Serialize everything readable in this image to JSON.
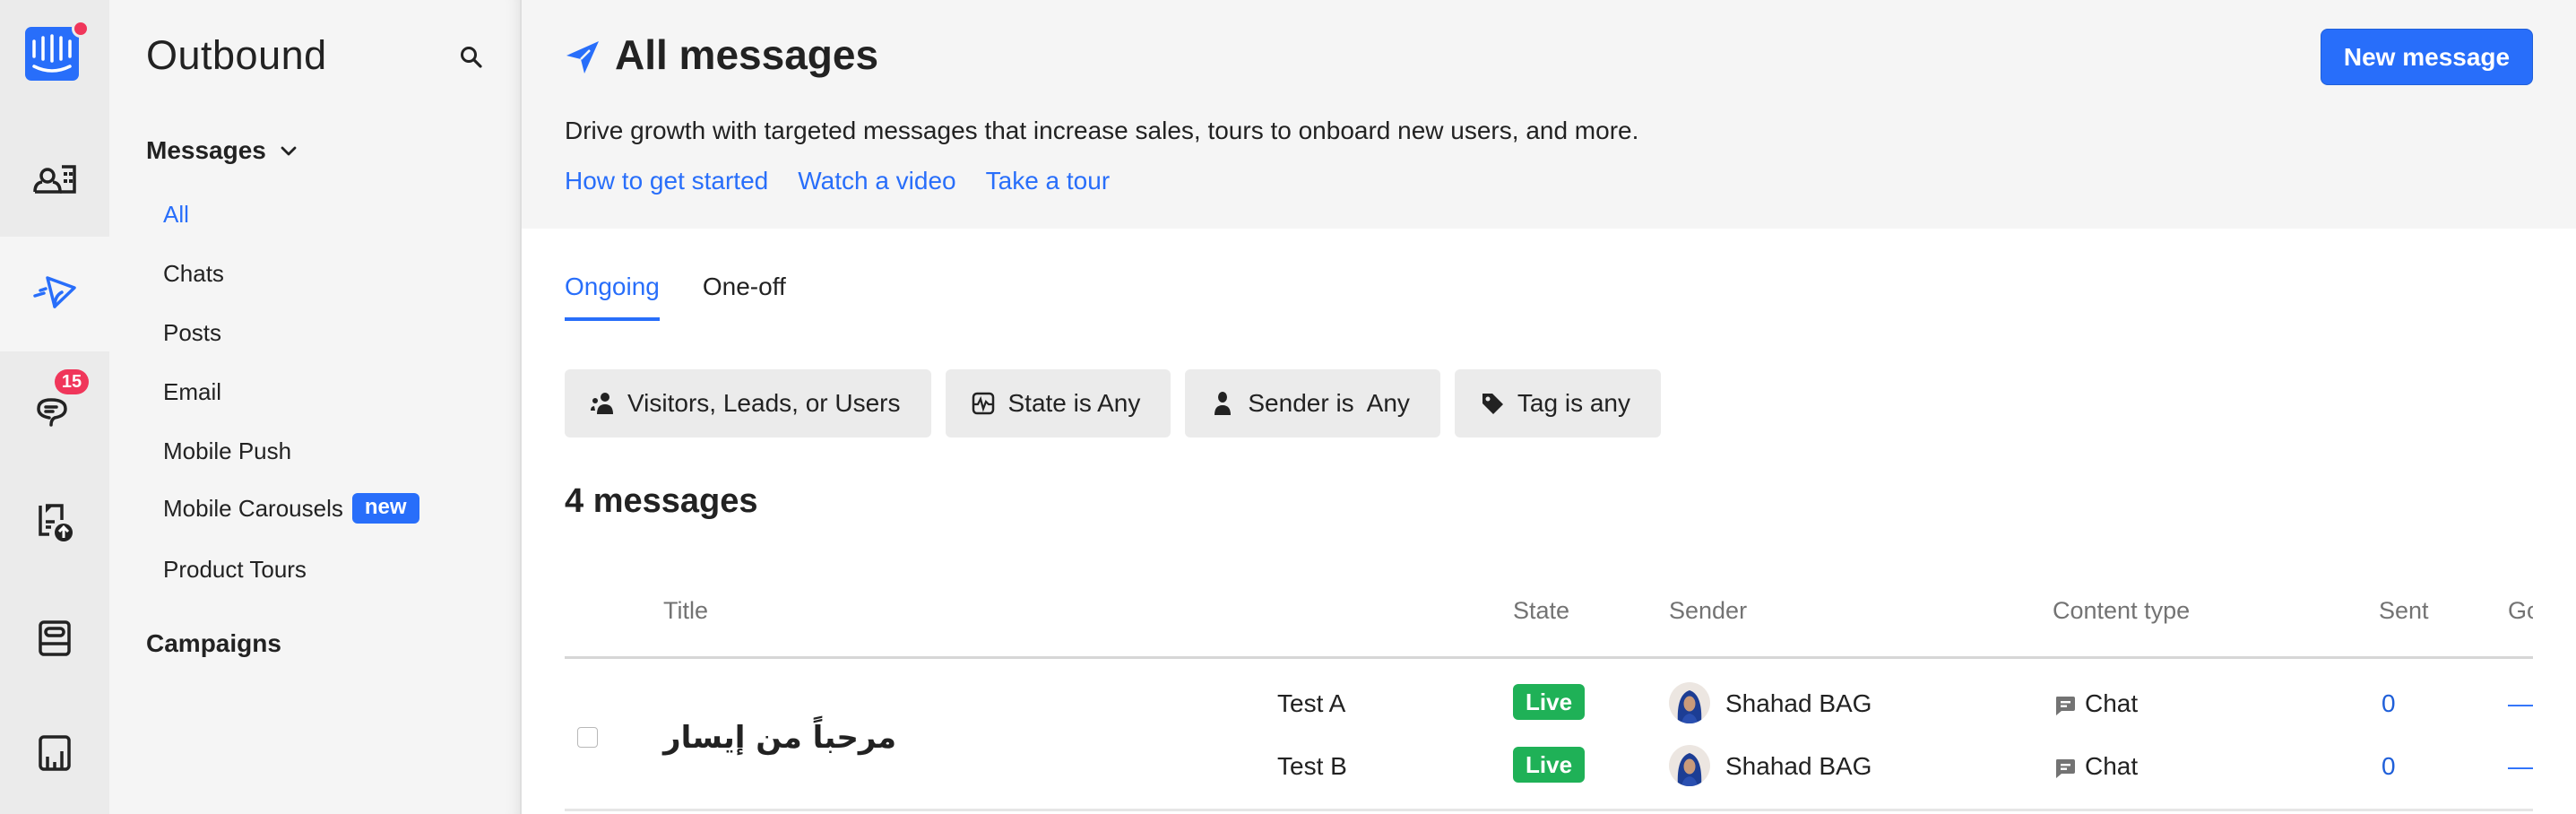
{
  "colors": {
    "accent": "#286efa",
    "badge_red": "#f0365a",
    "live_green": "#1fb157",
    "rail_bg": "#ebebeb",
    "panel_bg": "#f5f5f5"
  },
  "rail": {
    "logo": "intercom-logo",
    "items": [
      {
        "icon": "contacts-icon",
        "active": false
      },
      {
        "icon": "outbound-send-icon",
        "active": true
      },
      {
        "icon": "conversations-icon",
        "active": false,
        "badge": "15"
      },
      {
        "icon": "articles-upload-icon",
        "active": false
      },
      {
        "icon": "inbox-tray-icon",
        "active": false
      },
      {
        "icon": "reports-chart-icon",
        "active": false
      }
    ]
  },
  "sidebar": {
    "title": "Outbound",
    "search_icon": "search-icon",
    "messages_section": "Messages",
    "items": [
      {
        "label": "All",
        "active": true
      },
      {
        "label": "Chats"
      },
      {
        "label": "Posts"
      },
      {
        "label": "Email"
      },
      {
        "label": "Mobile Push"
      },
      {
        "label": "Mobile Carousels",
        "badge": "new"
      },
      {
        "label": "Product Tours"
      }
    ],
    "campaigns_section": "Campaigns"
  },
  "header": {
    "title": "All messages",
    "description": "Drive growth with targeted messages that increase sales, tours to onboard new users, and more.",
    "links": [
      "How to get started",
      "Watch a video",
      "Take a tour"
    ],
    "new_message_button": "New message"
  },
  "tabs": [
    {
      "label": "Ongoing",
      "active": true
    },
    {
      "label": "One-off",
      "active": false
    }
  ],
  "filters": [
    {
      "icon": "people-icon",
      "label": "Visitors, Leads, or Users"
    },
    {
      "icon": "state-pulse-icon",
      "label": "State is Any"
    },
    {
      "icon": "person-icon",
      "label": "Sender is",
      "value": "Any"
    },
    {
      "icon": "tag-icon",
      "label": "Tag is any"
    }
  ],
  "count_label": "4 messages",
  "table": {
    "columns": [
      "Title",
      "State",
      "Sender",
      "Content type",
      "Sent",
      "Go"
    ],
    "rows": [
      {
        "title": "مرحباً من إيسار",
        "variants": [
          {
            "name": "Test A",
            "state": "Live",
            "sender": "Shahad BAG",
            "content_type": "Chat",
            "sent": "0",
            "goal": "—"
          },
          {
            "name": "Test B",
            "state": "Live",
            "sender": "Shahad BAG",
            "content_type": "Chat",
            "sent": "0",
            "goal": "—"
          }
        ]
      }
    ]
  }
}
